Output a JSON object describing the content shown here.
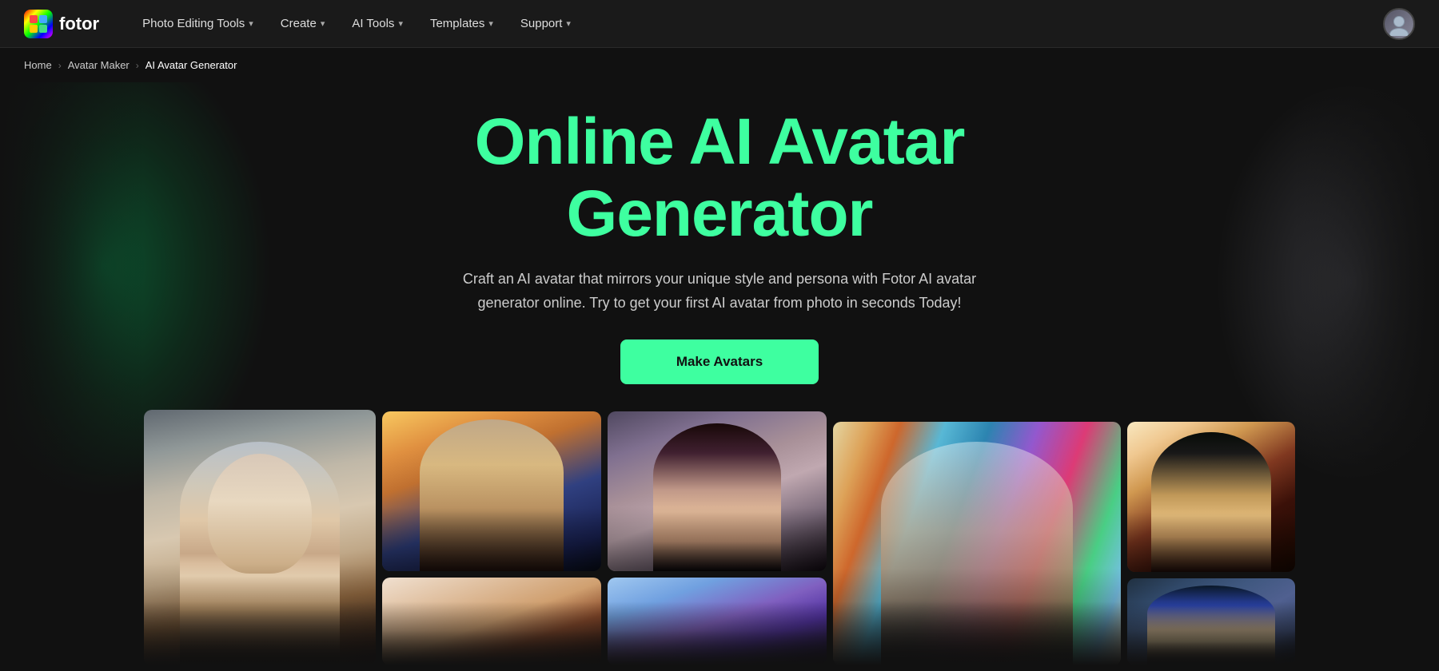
{
  "nav": {
    "logo_text": "fotor",
    "items": [
      {
        "label": "Photo Editing Tools",
        "has_chevron": true
      },
      {
        "label": "Create",
        "has_chevron": true
      },
      {
        "label": "AI Tools",
        "has_chevron": true
      },
      {
        "label": "Templates",
        "has_chevron": true
      },
      {
        "label": "Support",
        "has_chevron": true
      }
    ]
  },
  "breadcrumb": {
    "home": "Home",
    "parent": "Avatar Maker",
    "current": "AI Avatar Generator"
  },
  "hero": {
    "title": "Online AI Avatar Generator",
    "subtitle": "Craft an AI avatar that mirrors your unique style and persona with Fotor AI avatar generator online. Try to get your first AI avatar from photo in seconds Today!",
    "cta_label": "Make Avatars"
  },
  "colors": {
    "accent": "#3effa0",
    "bg": "#111111",
    "nav_bg": "#1a1a1a",
    "text_primary": "#ffffff",
    "text_secondary": "#cccccc"
  }
}
